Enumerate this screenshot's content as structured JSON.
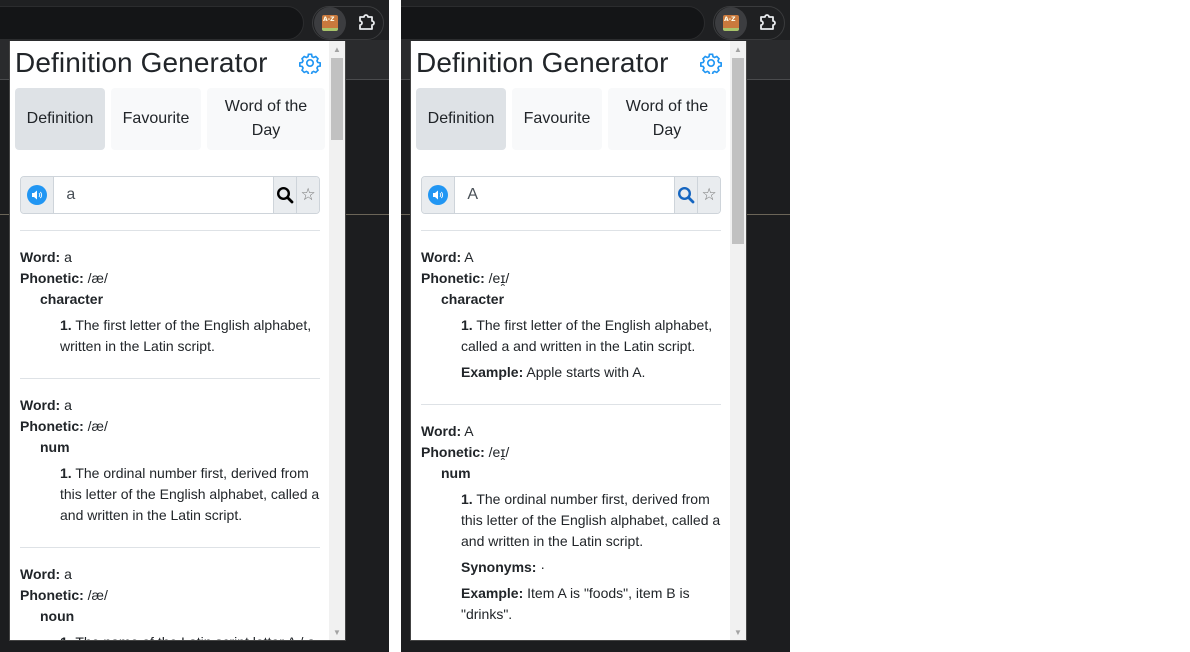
{
  "colors": {
    "accent": "#2196f3",
    "tab_active": "#dee2e6",
    "tab_inactive": "#f8f9fa",
    "search_icon_active": "#1565c0",
    "text": "#212529"
  },
  "extension_icon": {
    "name": "book-az-icon",
    "label": "A-Z"
  },
  "screens": [
    {
      "title": "Definition Generator",
      "tabs": [
        {
          "label": "Definition",
          "active": true
        },
        {
          "label": "Favourite",
          "active": false
        },
        {
          "label": "Word of the Day",
          "active": false
        }
      ],
      "search": {
        "value": "a",
        "search_icon_color": "#000000"
      },
      "labels": {
        "word": "Word:",
        "phonetic": "Phonetic:",
        "example": "Example:",
        "synonyms": "Synonyms:"
      },
      "entries": [
        {
          "word": "a",
          "phonetic": "/æ/",
          "part_of_speech": "character",
          "definitions": [
            {
              "num": "1.",
              "text": "The first letter of the English alphabet, written in the Latin script."
            }
          ]
        },
        {
          "word": "a",
          "phonetic": "/æ/",
          "part_of_speech": "num",
          "definitions": [
            {
              "num": "1.",
              "text": "The ordinal number first, derived from this letter of the English alphabet, called a and written in the Latin script."
            }
          ]
        },
        {
          "word": "a",
          "phonetic": "/æ/",
          "part_of_speech": "noun",
          "definitions": [
            {
              "num": "1.",
              "text": "The name of the Latin script letter A / a."
            }
          ]
        }
      ]
    },
    {
      "title": "Definition Generator",
      "tabs": [
        {
          "label": "Definition",
          "active": true
        },
        {
          "label": "Favourite",
          "active": false
        },
        {
          "label": "Word of the Day",
          "active": false
        }
      ],
      "search": {
        "value": "A",
        "search_icon_color": "#1565c0"
      },
      "labels": {
        "word": "Word:",
        "phonetic": "Phonetic:",
        "example": "Example:",
        "synonyms": "Synonyms:"
      },
      "entries": [
        {
          "word": "A",
          "phonetic": "/eɪ̯/",
          "part_of_speech": "character",
          "definitions": [
            {
              "num": "1.",
              "text": "The first letter of the English alphabet, called a and written in the Latin script.",
              "example": "Apple starts with A."
            }
          ]
        },
        {
          "word": "A",
          "phonetic": "/eɪ̯/",
          "part_of_speech": "num",
          "definitions": [
            {
              "num": "1.",
              "text": "The ordinal number first, derived from this letter of the English alphabet, called a and written in the Latin script.",
              "synonyms": "·",
              "example": "Item A is \"foods\", item B is \"drinks\"."
            }
          ]
        }
      ]
    }
  ]
}
